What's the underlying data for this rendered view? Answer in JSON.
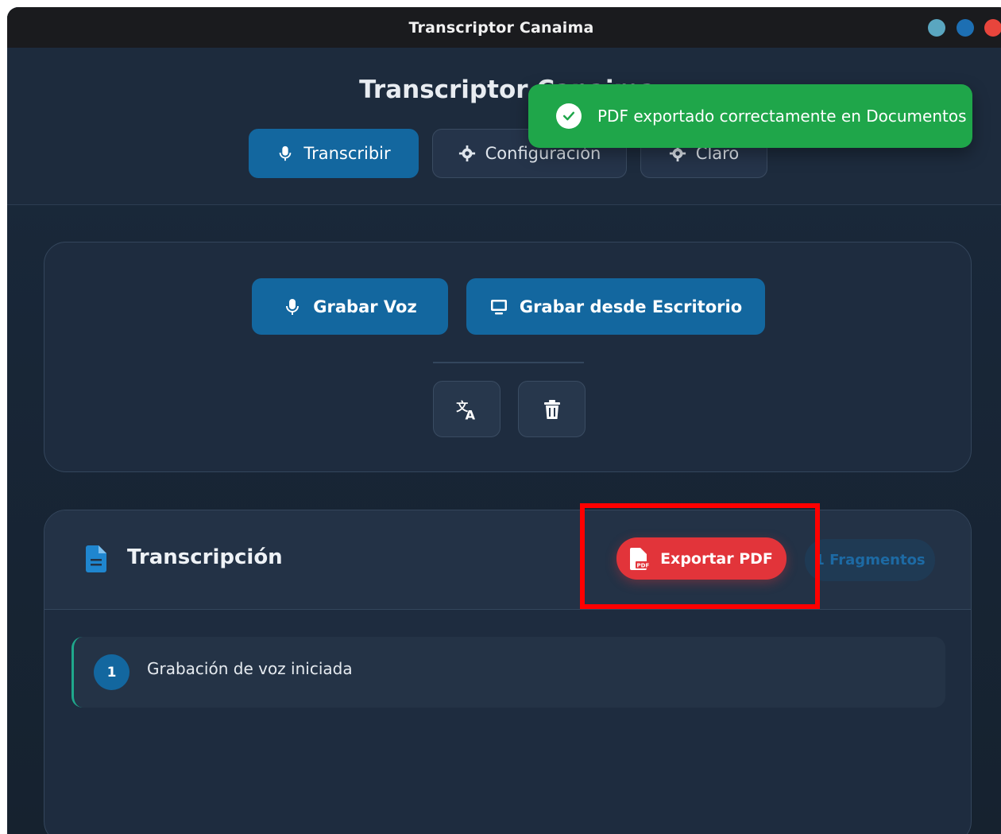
{
  "window": {
    "title": "Transcriptor Canaima"
  },
  "header": {
    "app_title": "Transcriptor Canaima",
    "nav": [
      {
        "label": "Transcribir",
        "icon": "microphone-icon",
        "active": true
      },
      {
        "label": "Configuración",
        "icon": "gear-icon",
        "active": false
      },
      {
        "label": "Claro",
        "icon": "gear-icon",
        "active": false
      }
    ]
  },
  "toast": {
    "message": "PDF exportado correctamente en Documentos",
    "icon": "check-circle-icon",
    "color": "#1fa64a"
  },
  "controls": {
    "record_voice_label": "Grabar Voz",
    "record_desktop_label": "Grabar desde Escritorio",
    "translate_icon": "translate-icon",
    "delete_icon": "trash-icon"
  },
  "transcription": {
    "title": "Transcripción",
    "export_label": "Exportar PDF",
    "fragments_label": "1 Fragmentos",
    "entries": [
      {
        "number": "1",
        "text": "Grabación de voz iniciada"
      }
    ]
  },
  "colors": {
    "accent": "#13679f",
    "danger": "#e2343a",
    "success": "#1fa64a"
  }
}
